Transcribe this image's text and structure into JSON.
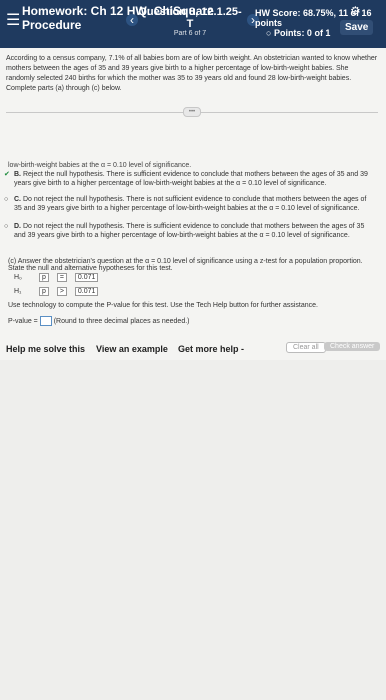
{
  "header": {
    "menu_icon": "hamburger-icon",
    "hw_title": "Homework: Ch 12 HW: ChiSquare",
    "hw_subtitle": "Procedure",
    "question": "Question 8, 12.1.25-T",
    "part": "Part 6 of 7",
    "score": "HW Score: 68.75%, 11 of 16 points",
    "points": "Points: 0 of 1",
    "save": "Save"
  },
  "problem": {
    "text": "According to a census company, 7.1% of all babies born are of low birth weight. An obstetrician wanted to know whether mothers between the ages of 35 and 39 years give birth to a higher percentage of low-birth-weight babies. She randomly selected 240 births for which the mother was 35 to 39 years old and found 28 low-birth-weight babies. Complete parts (a) through (c) below."
  },
  "previous_line": "low-birth-weight babies at the α = 0.10 level of significance.",
  "options": [
    {
      "letter": "B.",
      "text": "Reject the null hypothesis. There is sufficient evidence to conclude that mothers between the ages of 35 and 39 years give birth to a higher percentage of low-birth-weight babies at the α = 0.10 level of significance."
    },
    {
      "letter": "C.",
      "text": "Do not reject the null hypothesis. There is not sufficient evidence to conclude that mothers between the ages of 35 and 39 years give birth to a higher percentage of low-birth-weight babies at the α = 0.10 level of significance."
    },
    {
      "letter": "D.",
      "text": "Do not reject the null hypothesis. There is sufficient evidence to conclude that mothers between the ages of 35 and 39 years give birth to a higher percentage of low-birth-weight babies at the α = 0.10 level of significance."
    }
  ],
  "part_c": "(c) Answer the obstetrician's question at the α = 0.10 level of significance using a z-test for a population proportion. State the null and alternative hypotheses for this test.",
  "hypotheses": {
    "h0_label": "H₀",
    "h0_p": "p",
    "h0_op": "=",
    "h0_val": "0.071",
    "h1_label": "H₁",
    "h1_p": "p",
    "h1_op": ">",
    "h1_val": "0.071"
  },
  "tech": "Use technology to compute the P-value for this test. Use the Tech Help button for further assistance.",
  "pvalue": {
    "label": "P-value =",
    "hint": "(Round to three decimal places as needed.)"
  },
  "bottom": {
    "help": "Help me solve this",
    "example": "View an example",
    "more": "Get more help -",
    "clear": "Clear all",
    "check": "Check answer"
  }
}
